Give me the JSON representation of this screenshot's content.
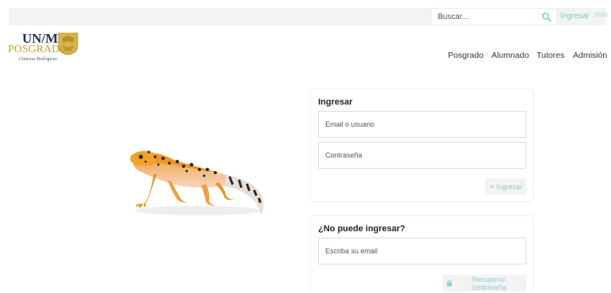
{
  "topbar": {
    "search_placeholder": "Buscar...",
    "login_label": "Ingresar",
    "lang_label": "ENG"
  },
  "logo": {
    "line1": "UN/M",
    "line2": "POSGRADO",
    "subtitle": "Ciencias Biológicas"
  },
  "nav": {
    "items": [
      {
        "label": "Posgrado"
      },
      {
        "label": "Alumnado"
      },
      {
        "label": "Tutores"
      },
      {
        "label": "Admisión"
      }
    ]
  },
  "login_panel": {
    "title": "Ingresar",
    "username_placeholder": "Email o usuario",
    "password_placeholder": "Contraseña",
    "submit_label": "Ingresar"
  },
  "recover_panel": {
    "title": "¿No puede ingresar?",
    "email_placeholder": "Escriba su email",
    "submit_label": "Recuperar contraseña"
  },
  "colors": {
    "accent": "#7cc7cf",
    "topbar_bg": "#f3f3f3",
    "logo_blue": "#1c2f5a",
    "logo_gold": "#c9a227"
  },
  "icons": [
    "search-icon",
    "sign-in-icon",
    "lock-icon",
    "unam-seal-icon"
  ]
}
